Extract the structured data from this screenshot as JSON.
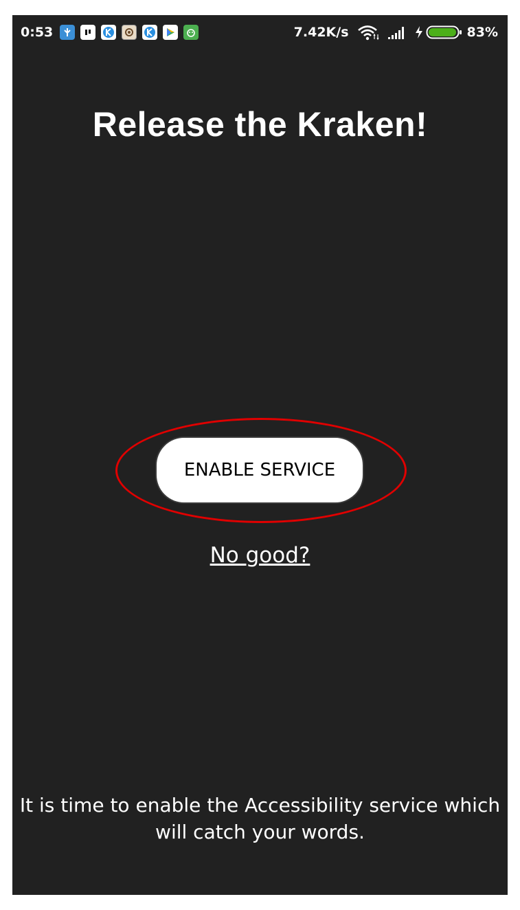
{
  "status_bar": {
    "time": "0:53",
    "net_speed": "7.42K/s",
    "battery_percent": "83%",
    "battery_level": 0.83,
    "notification_icons": [
      "vpn-icon",
      "app-icon",
      "k-app-icon",
      "photo-app-icon",
      "k-app-icon",
      "play-store-icon",
      "android-app-icon"
    ]
  },
  "main": {
    "title": "Release the Kraken!",
    "enable_button_label": "ENABLE SERVICE",
    "no_good_link": "No good?",
    "footer_line1": "It is time to enable the Accessibility service which",
    "footer_line2": "will catch your words."
  },
  "colors": {
    "background": "#212121",
    "button": "#ffffff",
    "highlight": "#e00000",
    "battery": "#4caf1a"
  }
}
